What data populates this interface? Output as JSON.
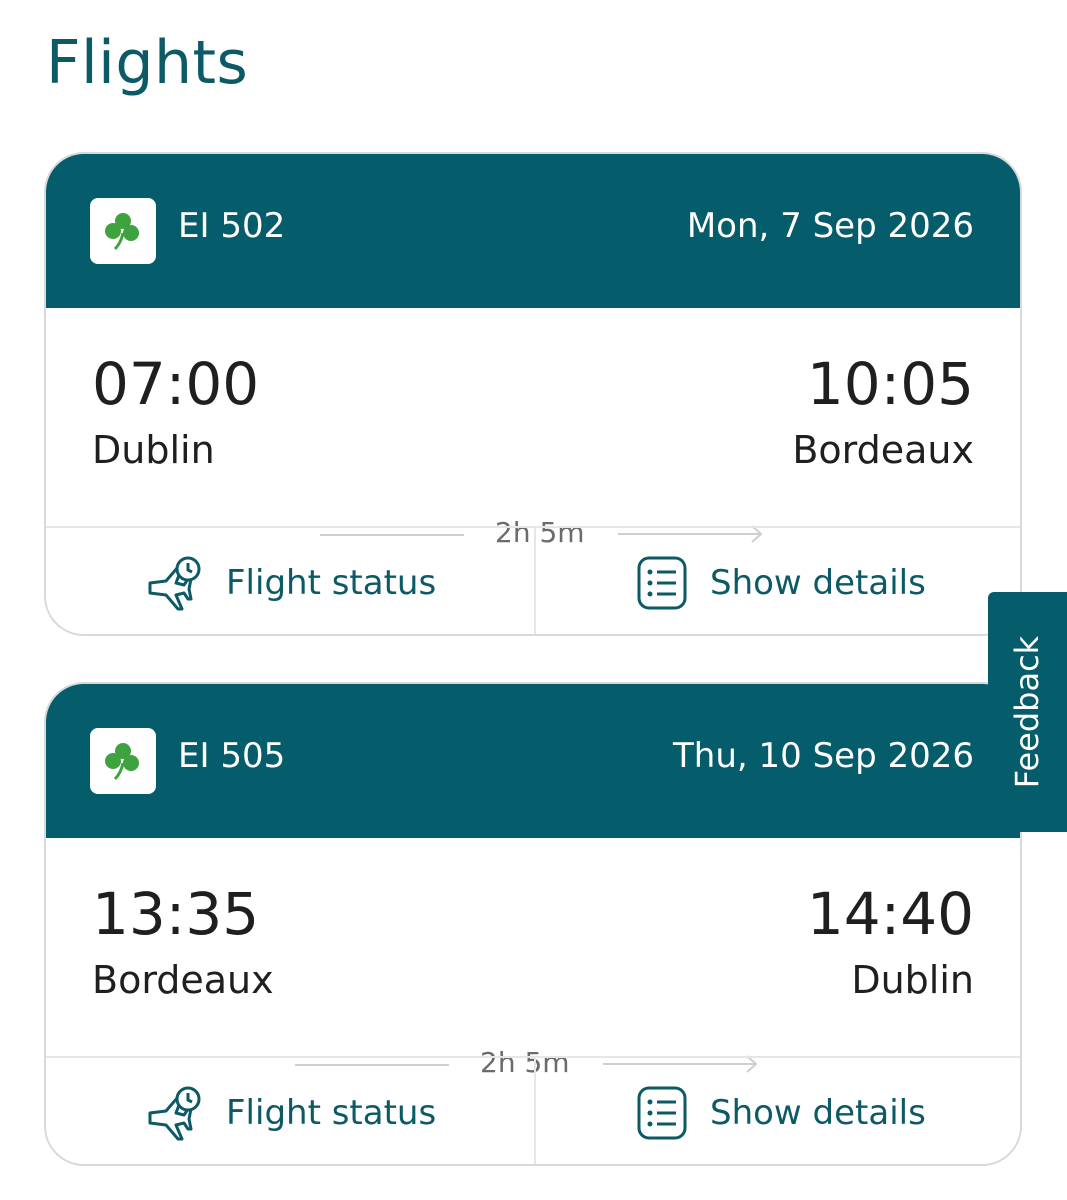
{
  "page": {
    "title": "Flights"
  },
  "colors": {
    "brand": "#055c6b",
    "title": "#0c5a66",
    "shamrock": "#3ea23f"
  },
  "flights": [
    {
      "flight_number": "EI 502",
      "date": "Mon, 7 Sep 2026",
      "departure_time": "07:00",
      "departure_city": "Dublin",
      "duration": "2h 5m",
      "arrival_time": "10:05",
      "arrival_city": "Bordeaux",
      "status_label": "Flight status",
      "details_label": "Show details"
    },
    {
      "flight_number": "EI 505",
      "date": "Thu, 10 Sep 2026",
      "departure_time": "13:35",
      "departure_city": "Bordeaux",
      "duration": "2h 5m",
      "arrival_time": "14:40",
      "arrival_city": "Dublin",
      "status_label": "Flight status",
      "details_label": "Show details"
    }
  ],
  "feedback": {
    "label": "Feedback"
  },
  "icons": {
    "logo": "shamrock-icon",
    "status": "plane-clock-icon",
    "details": "list-document-icon",
    "arrow": "arrow-right-icon"
  }
}
